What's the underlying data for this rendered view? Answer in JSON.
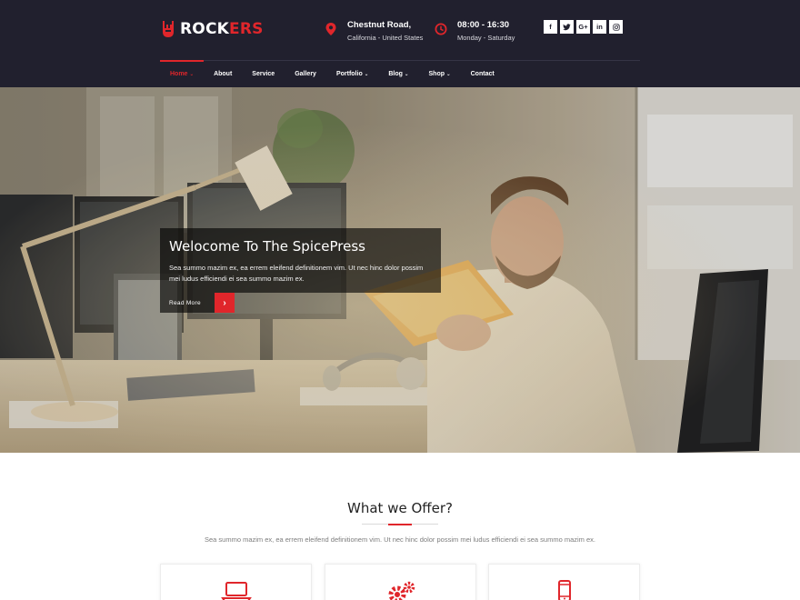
{
  "brand": {
    "name_part1": "ROCK",
    "name_part2": "ERS",
    "accent": "#e0262b",
    "header_bg": "#21202e"
  },
  "contact": {
    "address_title": "Chestnut Road,",
    "address_sub": "California - United States",
    "address_icon": "map-marker-icon",
    "hours_title": "08:00 - 16:30",
    "hours_sub": "Monday - Saturday",
    "hours_icon": "clock-icon"
  },
  "social": [
    {
      "label": "f",
      "icon": "facebook-icon"
    },
    {
      "label": "🐦",
      "icon": "twitter-icon"
    },
    {
      "label": "G+",
      "icon": "google-plus-icon"
    },
    {
      "label": "in",
      "icon": "linkedin-icon"
    },
    {
      "label": "◎",
      "icon": "instagram-icon"
    }
  ],
  "nav": {
    "home": "Home",
    "about": "About",
    "service": "Service",
    "gallery": "Gallery",
    "portfolio": "Portfolio",
    "blog": "Blog",
    "shop": "Shop",
    "contact": "Contact",
    "caret": "⌄"
  },
  "hero": {
    "title": "Welocome To The SpicePress",
    "text": "Sea summo mazim ex, ea errem eleifend definitionem vim. Ut nec hinc dolor possim mei ludus efficiendi ei sea summo mazim ex.",
    "button_label": "Read More",
    "button_icon": "›"
  },
  "offer": {
    "title": "What we Offer?",
    "text": "Sea summo mazim ex, ea errem eleifend definitionem vim. Ut nec hinc dolor possim mei ludus efficiendi ei sea summo mazim ex.",
    "cards": [
      {
        "icon": "laptop-icon"
      },
      {
        "icon": "gears-icon"
      },
      {
        "icon": "mobile-icon"
      }
    ]
  }
}
